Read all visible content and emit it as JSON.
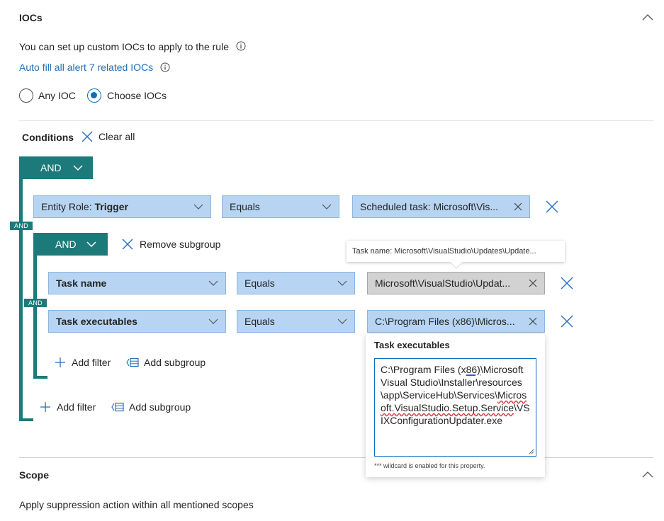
{
  "iocs": {
    "title": "IOCs",
    "description": "You can set up custom IOCs to apply to the rule",
    "autofill_link": "Auto fill all alert 7 related IOCs",
    "radio_any": "Any IOC",
    "radio_choose": "Choose IOCs",
    "selected": "Choose IOCs"
  },
  "conditions": {
    "label": "Conditions",
    "clear_all": "Clear all",
    "outer_operator": "AND",
    "outer_and_tag": "AND",
    "row1": {
      "field_prefix": "Entity Role: ",
      "field_value": "Trigger",
      "operator": "Equals",
      "value": "Scheduled task: Microsoft\\Vis..."
    },
    "subgroup": {
      "operator": "AND",
      "and_tag": "AND",
      "remove_label": "Remove subgroup",
      "tooltip": "Task name: Microsoft\\VisualStudio\\Updates\\Update...",
      "row1": {
        "field": "Task name",
        "operator": "Equals",
        "value": "Microsoft\\VisualStudio\\Updat..."
      },
      "row2": {
        "field": "Task executables",
        "operator": "Equals",
        "value": "C:\\Program Files (x86)\\Micros..."
      },
      "add_filter": "Add filter",
      "add_subgroup": "Add subgroup"
    },
    "add_filter": "Add filter",
    "add_subgroup": "Add subgroup"
  },
  "editor": {
    "title": "Task executables",
    "text": {
      "p1": "C:\\Program Files (x",
      "p2": "86)",
      "p3": "\\Microsoft Visual Studio\\Installer\\resources\\app\\ServiceHub\\Services\\",
      "p4": "Microsoft.VisualStudio.Setup.Service",
      "p5": "\\VSIXConfigurationUpdater.exe"
    },
    "hint": "*** wildcard is enabled for this property."
  },
  "scope": {
    "title": "Scope",
    "description": "Apply suppression action within all mentioned scopes"
  }
}
